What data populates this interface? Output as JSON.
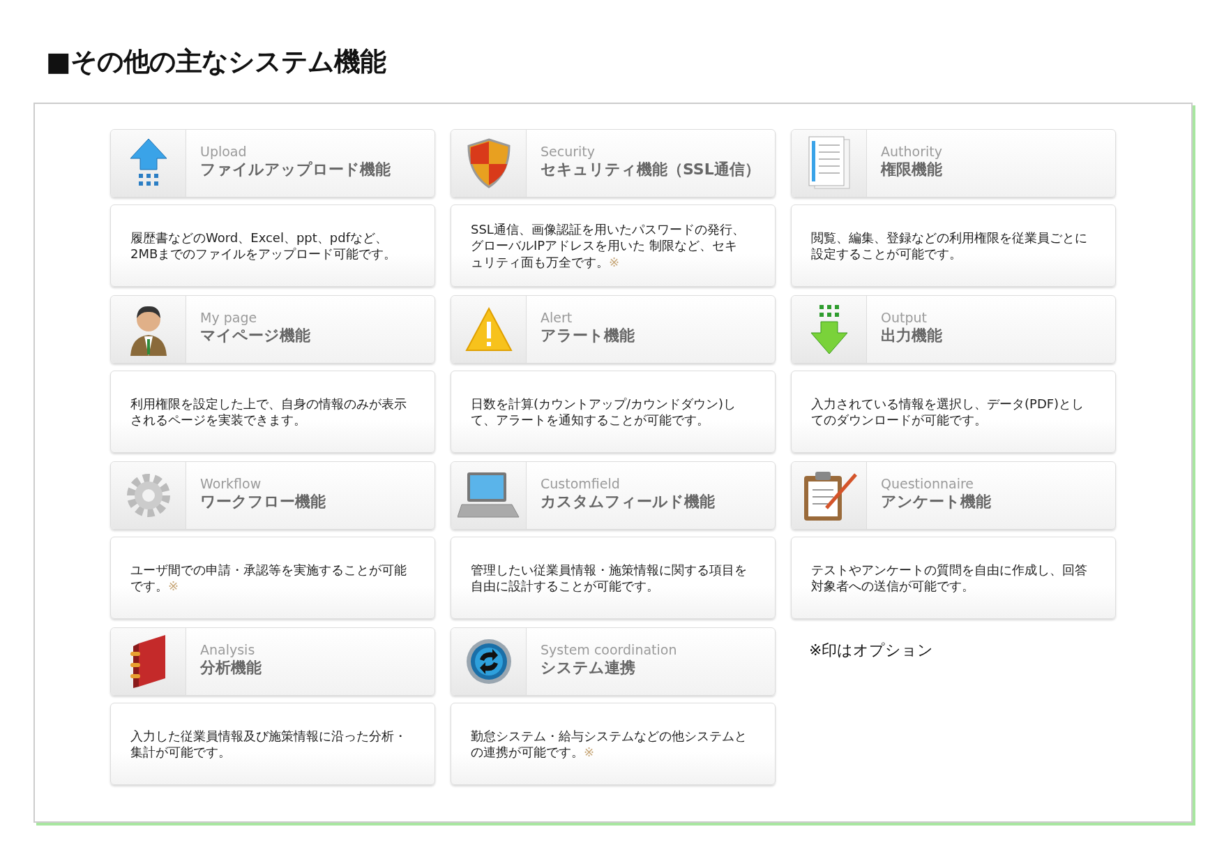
{
  "title": "■その他の主なシステム機能",
  "features": [
    {
      "label": "Upload",
      "name": "ファイルアップロード機能",
      "description": "履歴書などのWord、Excel、ppt、pdfなど、2MBまでのファイルをアップロード可能です。"
    },
    {
      "label": "Security",
      "name": "セキュリティ機能（SSL通信）",
      "description": "SSL通信、画像認証を用いたパスワードの発行、グローバルIPアドレスを用いた 制限など、セキュリティ面も万全です。",
      "option_mark": "※"
    },
    {
      "label": "Authority",
      "name": "権限機能",
      "description": "閲覧、編集、登録などの利用権限を従業員ごとに設定することが可能です。"
    },
    {
      "label": "My page",
      "name": "マイページ機能",
      "description": "利用権限を設定した上で、自身の情報のみが表示されるページを実装できます。"
    },
    {
      "label": "Alert",
      "name": "アラート機能",
      "description": "日数を計算(カウントアップ/カウンドダウン)して、アラートを通知することが可能です。"
    },
    {
      "label": "Output",
      "name": "出力機能",
      "description": "入力されている情報を選択し、データ(PDF)としてのダウンロードが可能です。"
    },
    {
      "label": "Workflow",
      "name": "ワークフロー機能",
      "description": "ユーザ間での申請・承認等を実施することが可能です。",
      "option_mark": "※"
    },
    {
      "label": "Customfield",
      "name": "カスタムフィールド機能",
      "description": "管理したい従業員情報・施策情報に関する項目を自由に設計することが可能です。"
    },
    {
      "label": "Questionnaire",
      "name": "アンケート機能",
      "description": "テストやアンケートの質問を自由に作成し、回答対象者への送信が可能です。"
    },
    {
      "label": "Analysis",
      "name": "分析機能",
      "description": "入力した従業員情報及び施策情報に沿った分析・集計が可能です。"
    },
    {
      "label": "System coordination",
      "name": "システム連携",
      "description": "勤怠システム・給与システムなどの他システムとの連携が可能です。",
      "option_mark": "※"
    }
  ],
  "note": "※印はオプション"
}
